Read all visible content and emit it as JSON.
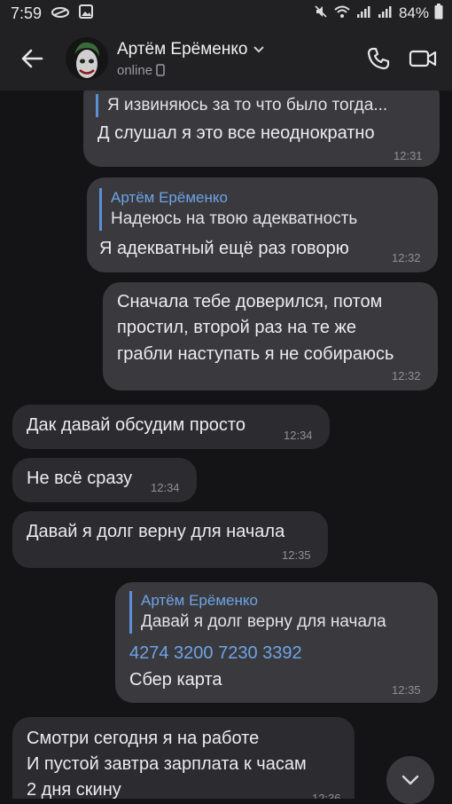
{
  "status_bar": {
    "time": "7:59",
    "battery": "84%"
  },
  "header": {
    "name": "Артём Ерёменко",
    "status": "online"
  },
  "messages": [
    {
      "quote_text": "Я извиняюсь за то что было тогда...",
      "text": "Д слушал я это все неоднократно",
      "time": "12:31"
    },
    {
      "quote_name": "Артём Ерёменко",
      "quote_text": "Надеюсь на твою адекватность",
      "text": "Я адекватный ещё раз говорю",
      "time": "12:32"
    },
    {
      "lines": [
        "Сначала тебе доверился, потом",
        "простил, второй раз на те же",
        "грабли наступать я не собираюсь"
      ],
      "time": "12:32"
    },
    {
      "text": "Дак давай обсудим просто",
      "time": "12:34"
    },
    {
      "text": "Не всё сразу",
      "time": "12:34"
    },
    {
      "text": "Давай я долг верну для начала",
      "time": "12:35"
    },
    {
      "quote_name": "Артём Ерёменко",
      "quote_text": "Давай я долг верну для начала",
      "card": "4274 3200 7230 3392",
      "text": "Сбер карта",
      "time": "12:35"
    },
    {
      "lines": [
        "Смотри сегодня я на работе",
        "И пустой завтра зарплата к часам",
        "2 дня скину"
      ],
      "time": "12:36"
    }
  ],
  "icons": [
    "back-arrow-icon",
    "phone-icon",
    "video-icon",
    "chevron-down-icon",
    "wifi-icon",
    "signal-icon",
    "battery-icon"
  ]
}
